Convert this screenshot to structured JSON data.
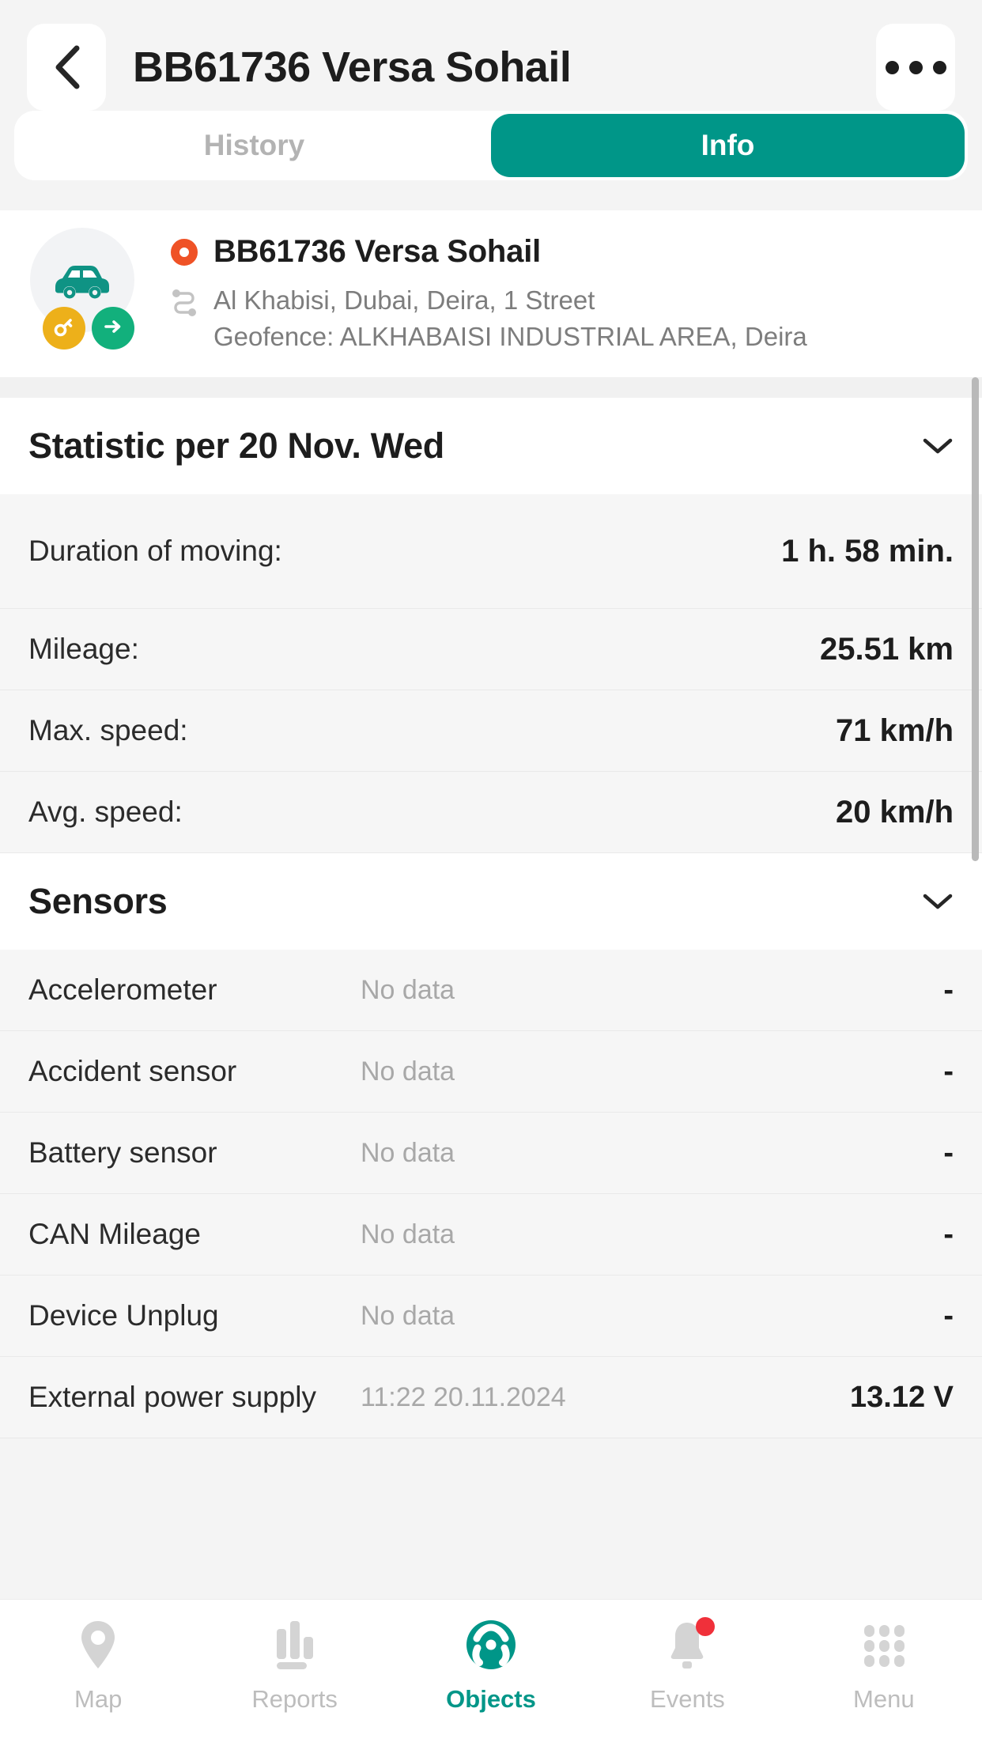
{
  "header": {
    "title": "BB61736 Versa Sohail",
    "back_icon": "chevron-left-icon",
    "more_icon": "more-options-icon"
  },
  "tabs": [
    {
      "label": "History",
      "active": false
    },
    {
      "label": "Info",
      "active": true
    }
  ],
  "object_card": {
    "avatar_icon": "car-icon",
    "badges": [
      {
        "name": "ignition-key-badge",
        "icon": "key-icon",
        "color": "#edb01a"
      },
      {
        "name": "moving-arrow-badge",
        "icon": "arrow-right-icon",
        "color": "#12b07c"
      }
    ],
    "status_color": "#ef5226",
    "name": "BB61736 Versa Sohail",
    "route_icon": "route-icon",
    "address": "Al Khabisi, Dubai, Deira, 1 Street",
    "geofence": "Geofence: ALKHABAISI INDUSTRIAL AREA, Deira"
  },
  "statistic": {
    "title": "Statistic per 20 Nov. Wed",
    "collapse_icon": "chevron-down-icon",
    "rows": [
      {
        "label": "Duration of moving:",
        "value": "1 h. 58 min."
      },
      {
        "label": "Mileage:",
        "value": "25.51 km"
      },
      {
        "label": "Max. speed:",
        "value": "71 km/h"
      },
      {
        "label": "Avg. speed:",
        "value": "20 km/h"
      }
    ]
  },
  "sensors": {
    "title": "Sensors",
    "collapse_icon": "chevron-down-icon",
    "rows": [
      {
        "name": "Accelerometer",
        "date": "No data",
        "value": "-"
      },
      {
        "name": "Accident sensor",
        "date": "No data",
        "value": "-"
      },
      {
        "name": "Battery sensor",
        "date": "No data",
        "value": "-"
      },
      {
        "name": "CAN Mileage",
        "date": "No data",
        "value": "-"
      },
      {
        "name": "Device Unplug",
        "date": "No data",
        "value": "-"
      },
      {
        "name": "External power supply",
        "date": "11:22 20.11.2024",
        "value": "13.12 V"
      }
    ]
  },
  "bottom_nav": [
    {
      "label": "Map",
      "icon": "map-pin-icon",
      "active": false,
      "badge": false
    },
    {
      "label": "Reports",
      "icon": "bar-chart-icon",
      "active": false,
      "badge": false
    },
    {
      "label": "Objects",
      "icon": "steering-wheel-icon",
      "active": true,
      "badge": false
    },
    {
      "label": "Events",
      "icon": "bell-icon",
      "active": false,
      "badge": true
    },
    {
      "label": "Menu",
      "icon": "grid-menu-icon",
      "active": false,
      "badge": false
    }
  ],
  "theme": {
    "accent": "#009688",
    "status": "#ef5226",
    "badge_red": "#f0303a",
    "muted": "#a8a8a8"
  }
}
